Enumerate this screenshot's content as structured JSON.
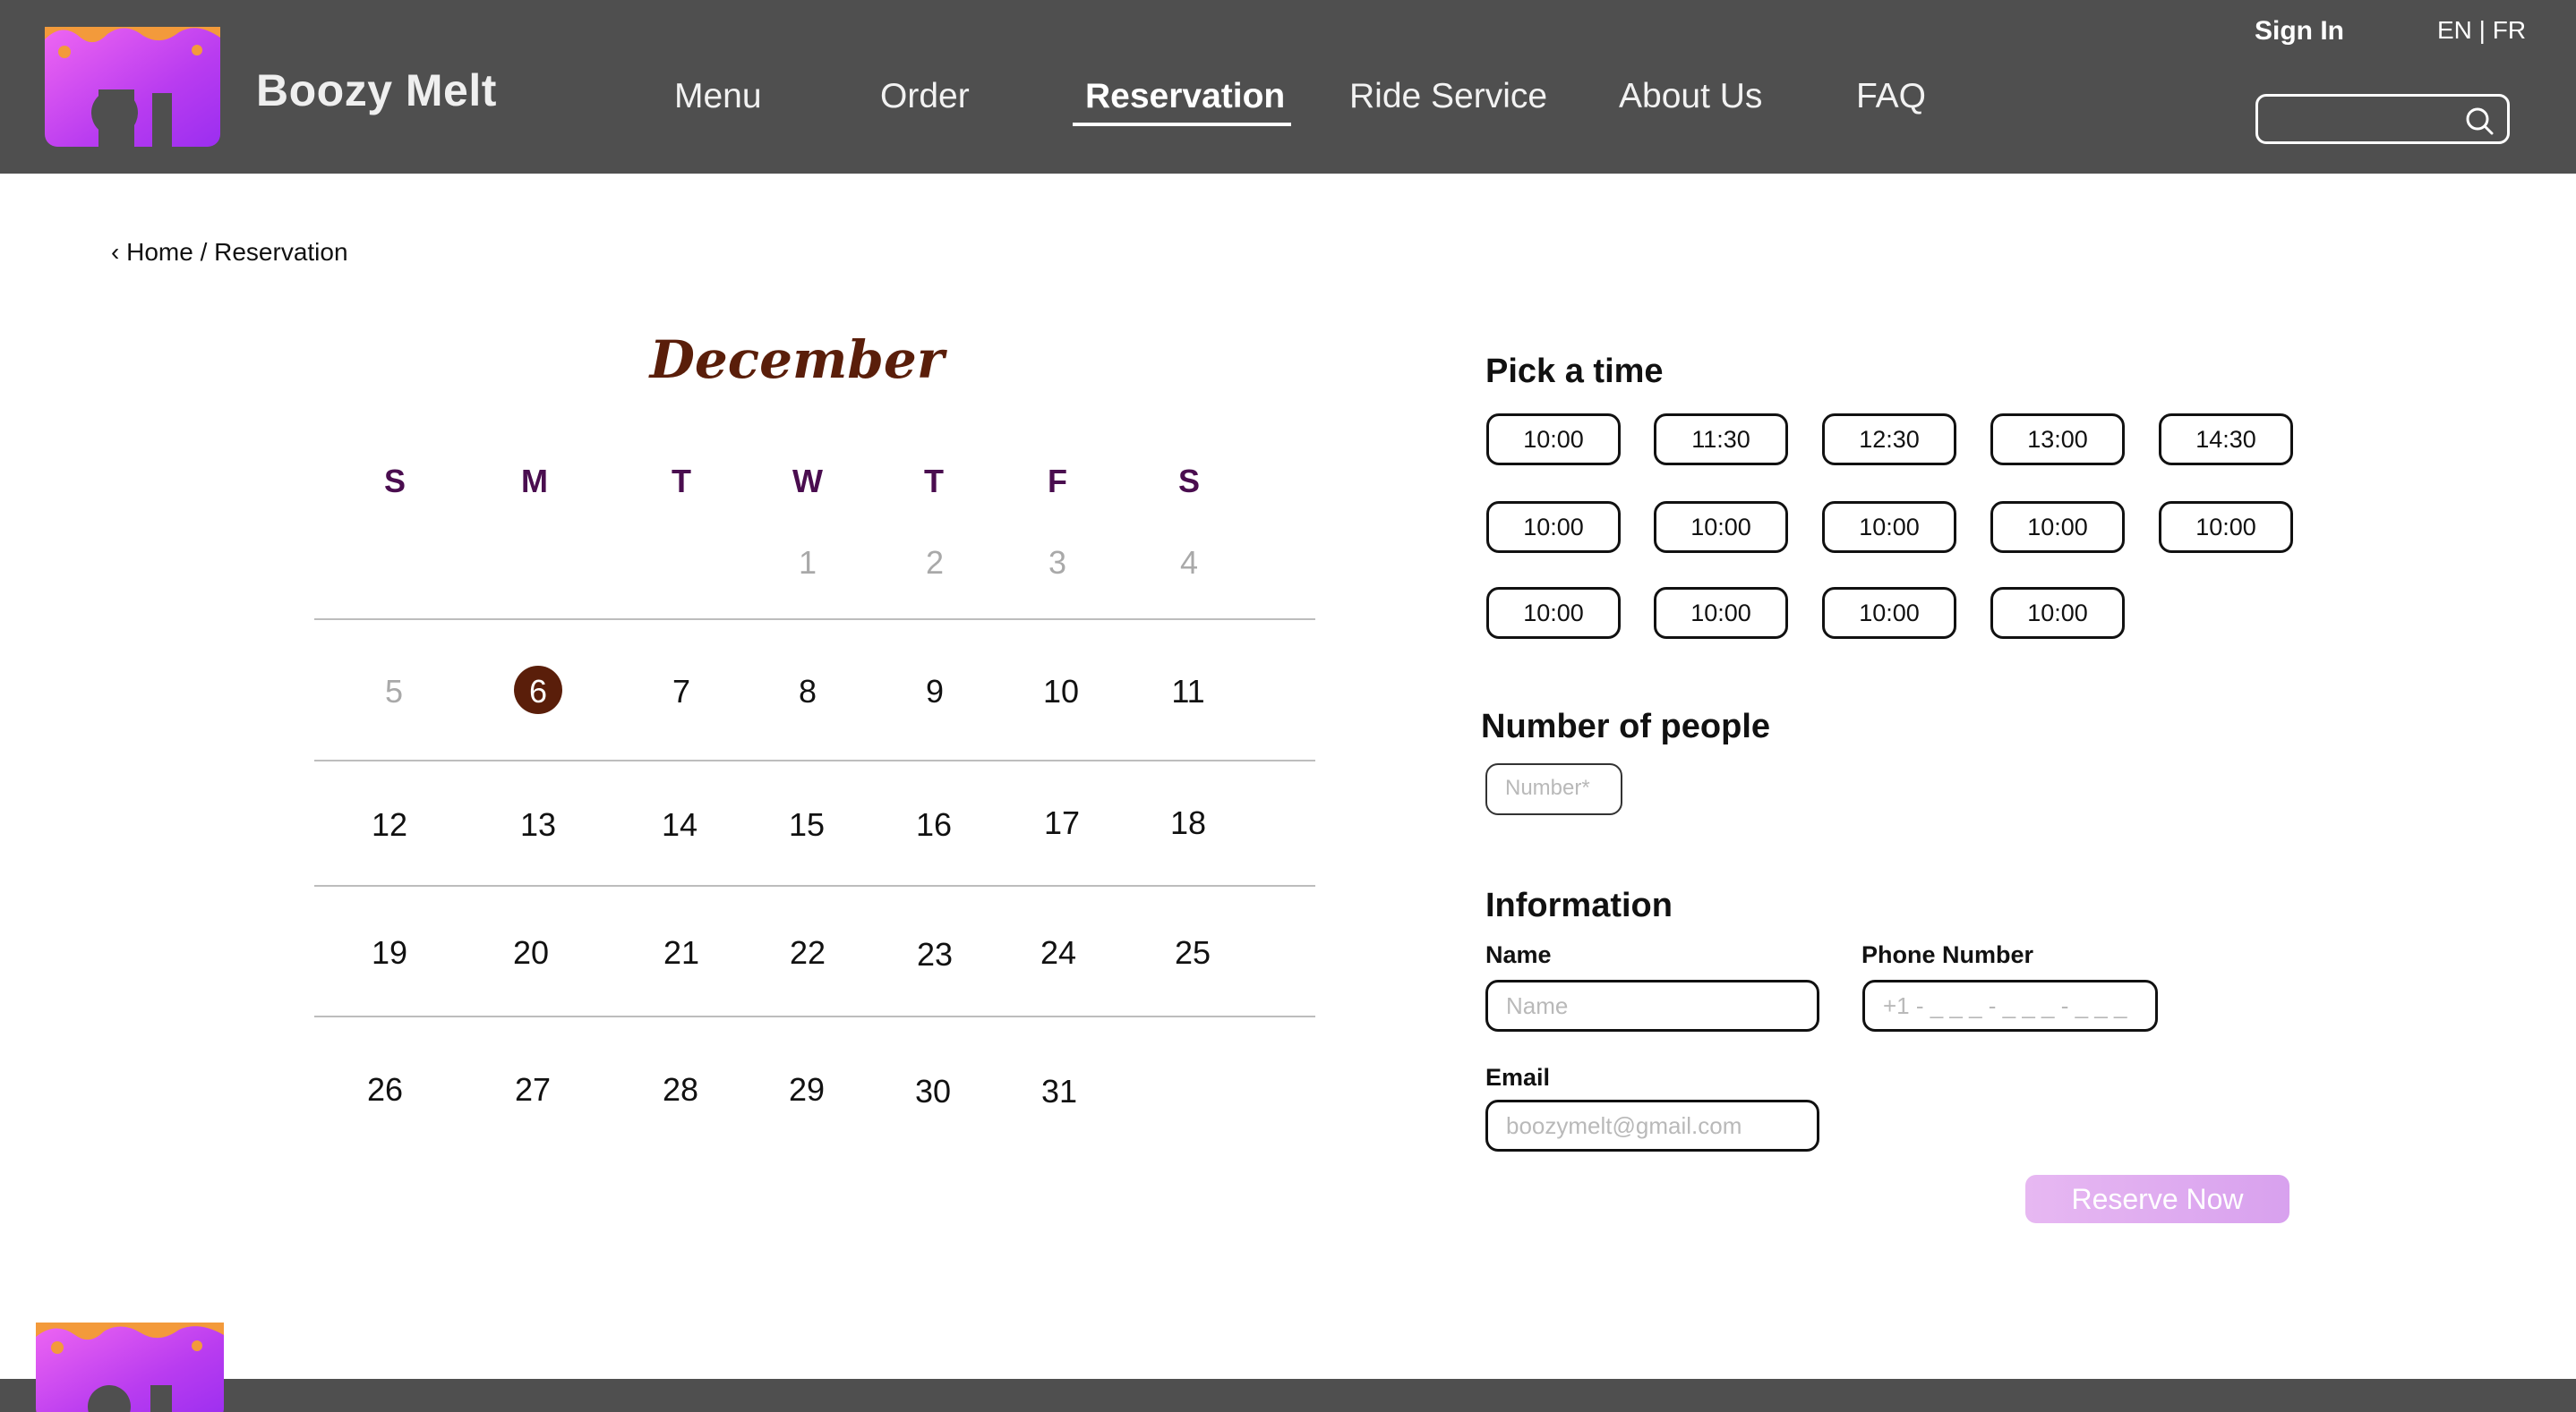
{
  "header": {
    "brand": "Boozy Melt",
    "nav": [
      "Menu",
      "Order",
      "Reservation",
      "Ride Service",
      "About Us",
      "FAQ"
    ],
    "active_nav": "Reservation",
    "sign_in": "Sign In",
    "language": "EN | FR",
    "search_placeholder": ""
  },
  "breadcrumb": "‹ Home / Reservation",
  "calendar": {
    "month": "December",
    "weekdays": [
      "S",
      "M",
      "T",
      "W",
      "T",
      "F",
      "S"
    ],
    "weeks": [
      [
        "",
        "",
        "",
        "1",
        "2",
        "3",
        "4"
      ],
      [
        "5",
        "6",
        "7",
        "8",
        "9",
        "10",
        "11"
      ],
      [
        "12",
        "13",
        "14",
        "15",
        "16",
        "17",
        "18"
      ],
      [
        "19",
        "20",
        "21",
        "22",
        "23",
        "24",
        "25"
      ],
      [
        "26",
        "27",
        "28",
        "29",
        "30",
        "31",
        ""
      ]
    ],
    "selected_day": "6",
    "muted_days": [
      "1",
      "2",
      "3",
      "4",
      "5"
    ]
  },
  "time_section": {
    "title": "Pick a time",
    "times": [
      [
        "10:00",
        "11:30",
        "12:30",
        "13:00",
        "14:30"
      ],
      [
        "10:00",
        "10:00",
        "10:00",
        "10:00",
        "10:00"
      ],
      [
        "10:00",
        "10:00",
        "10:00",
        "10:00"
      ]
    ]
  },
  "people_section": {
    "title": "Number of people",
    "placeholder": "Number*"
  },
  "info_section": {
    "title": "Information",
    "name_label": "Name",
    "name_placeholder": "Name",
    "phone_label": "Phone Number",
    "phone_placeholder": "+1 - _ _ _ - _ _ _ - _ _ _",
    "email_label": "Email",
    "email_placeholder": "boozymelt@gmail.com"
  },
  "reserve_button": "Reserve Now",
  "colors": {
    "header_bg": "#4f4f4f",
    "accent_brown": "#5a1e0a",
    "weekday_purple": "#4a0d4f",
    "reserve_button": "#dda6ef",
    "logo_purple": "#b93cf0",
    "logo_orange": "#f39a3b"
  }
}
